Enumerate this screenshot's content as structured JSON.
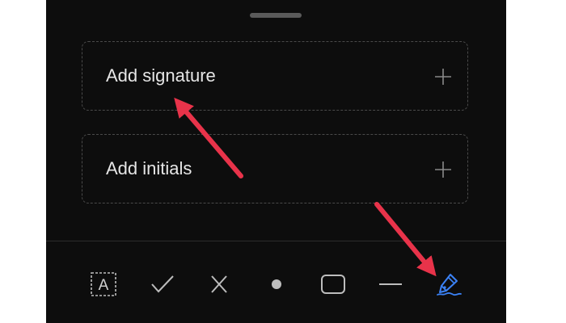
{
  "sheet": {
    "signature_label": "Add signature",
    "initials_label": "Add initials"
  },
  "toolbar": {
    "tools": [
      {
        "icon": "text-box-icon",
        "glyph": "A"
      },
      {
        "icon": "checkmark-icon"
      },
      {
        "icon": "cross-icon"
      },
      {
        "icon": "dot-icon"
      },
      {
        "icon": "rectangle-icon"
      },
      {
        "icon": "line-icon"
      },
      {
        "icon": "pen-sign-icon",
        "active": true
      }
    ]
  },
  "colors": {
    "background": "#0d0d0d",
    "text": "#e6e6e6",
    "icon": "#bdbdbd",
    "active_tool": "#3b82f6",
    "annotation_arrow": "#e8334a"
  }
}
